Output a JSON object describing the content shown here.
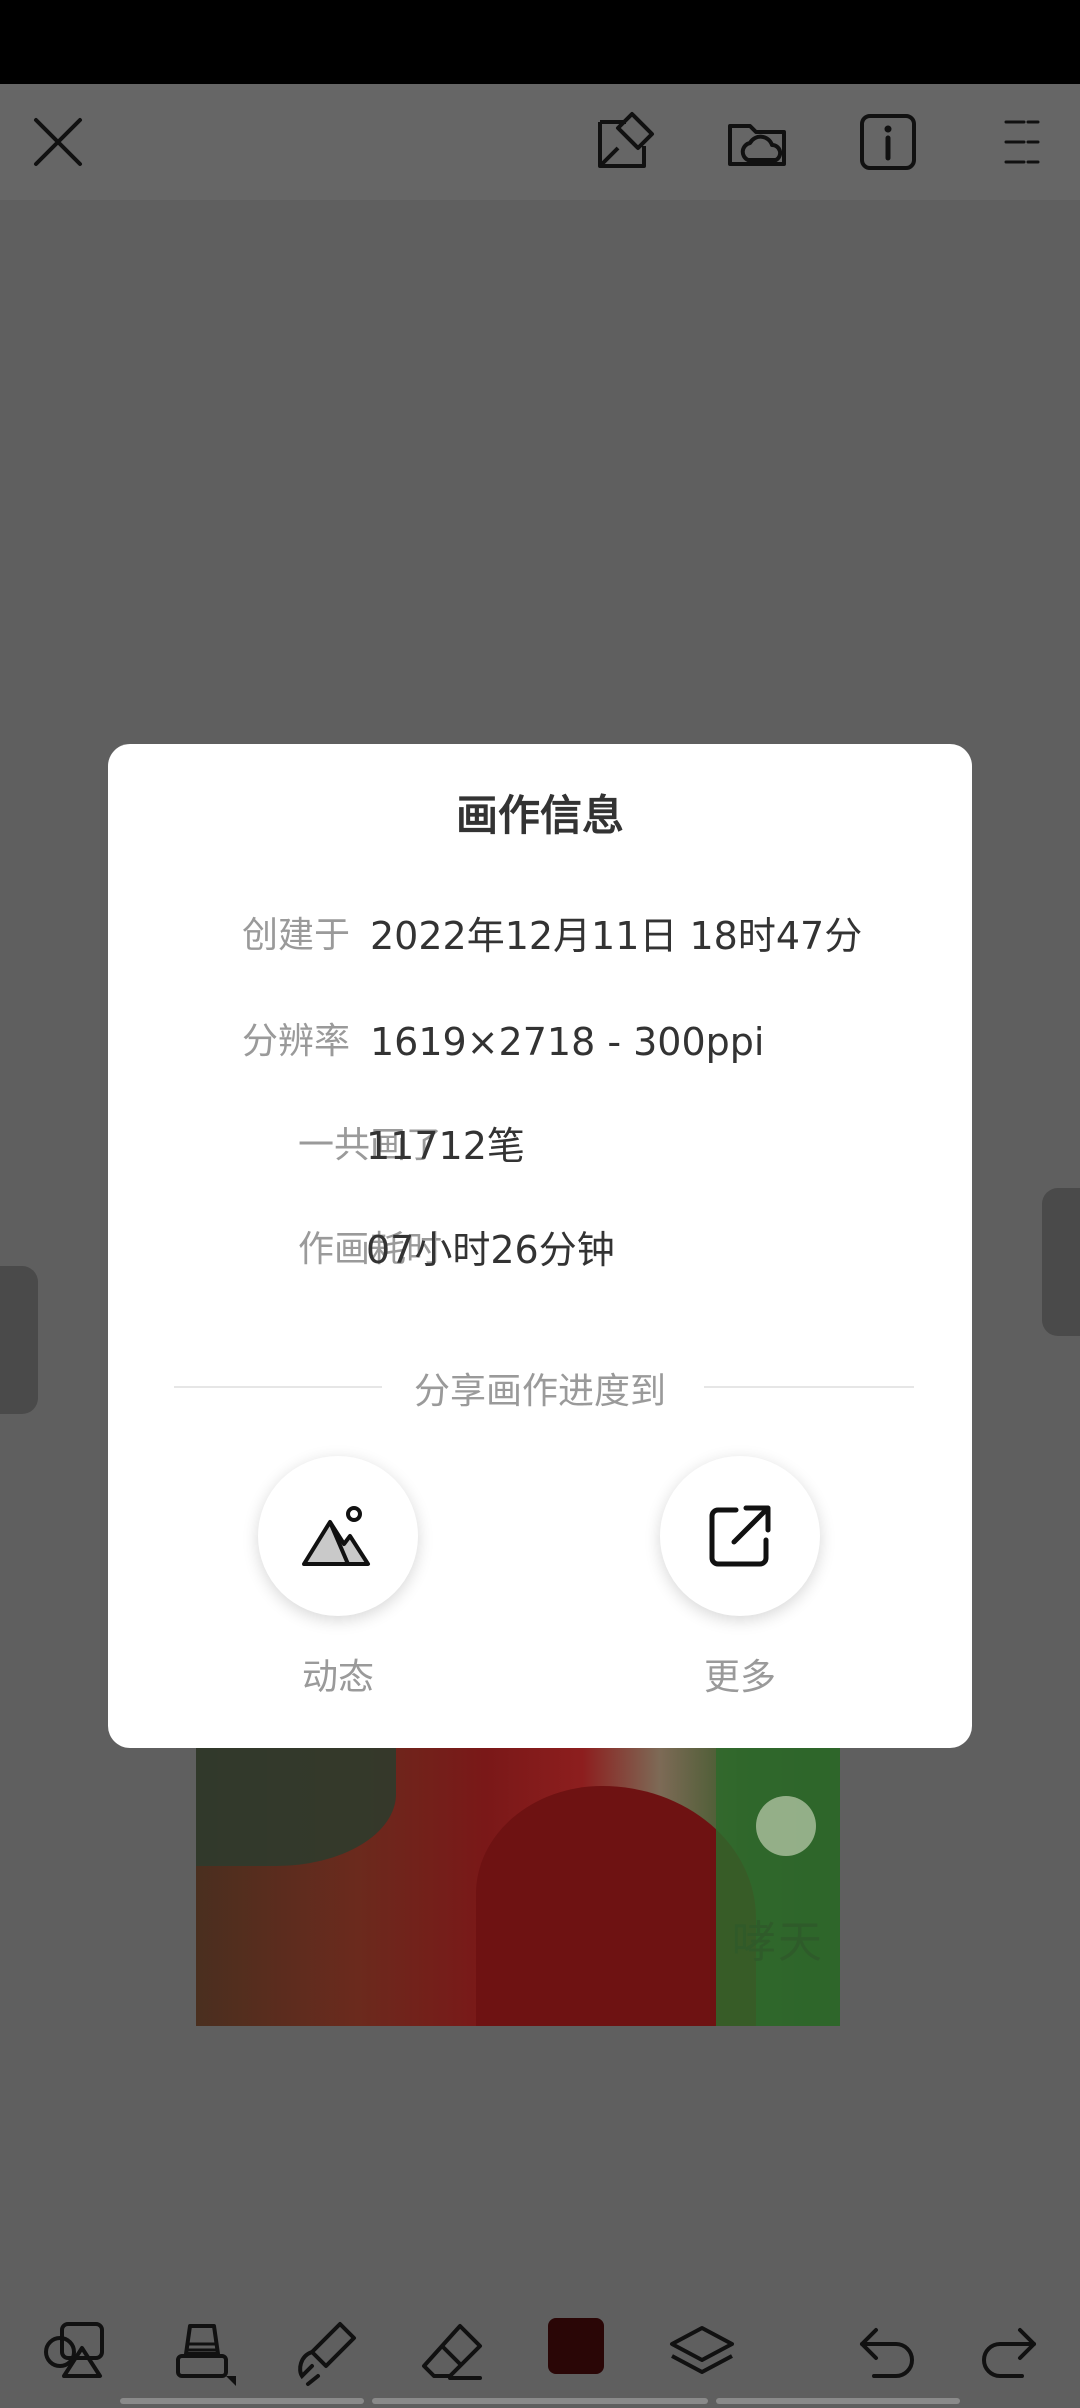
{
  "toolbar": {
    "icons": [
      "close-icon",
      "edit-canvas-icon",
      "cloud-folder-icon",
      "info-icon",
      "menu-icon"
    ]
  },
  "dialog": {
    "title": "画作信息",
    "rows": [
      {
        "label": "创建于",
        "value": "2022年12月11日 18时47分"
      },
      {
        "label": "分辨率",
        "value": "1619×2718 - 300ppi"
      },
      {
        "label": "一共画了",
        "value": "11712笔"
      },
      {
        "label": "作画耗时",
        "value": "07小时26分钟"
      }
    ],
    "share_heading": "分享画作进度到",
    "share_options": [
      {
        "label": "动态",
        "icon": "mountain-moment-icon"
      },
      {
        "label": "更多",
        "icon": "external-share-icon"
      }
    ]
  },
  "artwork": {
    "watermark": "哮天"
  },
  "bottom_toolbar": {
    "icons": [
      "shapes-icon",
      "brush-tool-icon",
      "smudge-icon",
      "eraser-icon",
      "color-swatch",
      "layers-icon",
      "undo-icon",
      "redo-icon"
    ],
    "current_color": "#2a0606"
  }
}
